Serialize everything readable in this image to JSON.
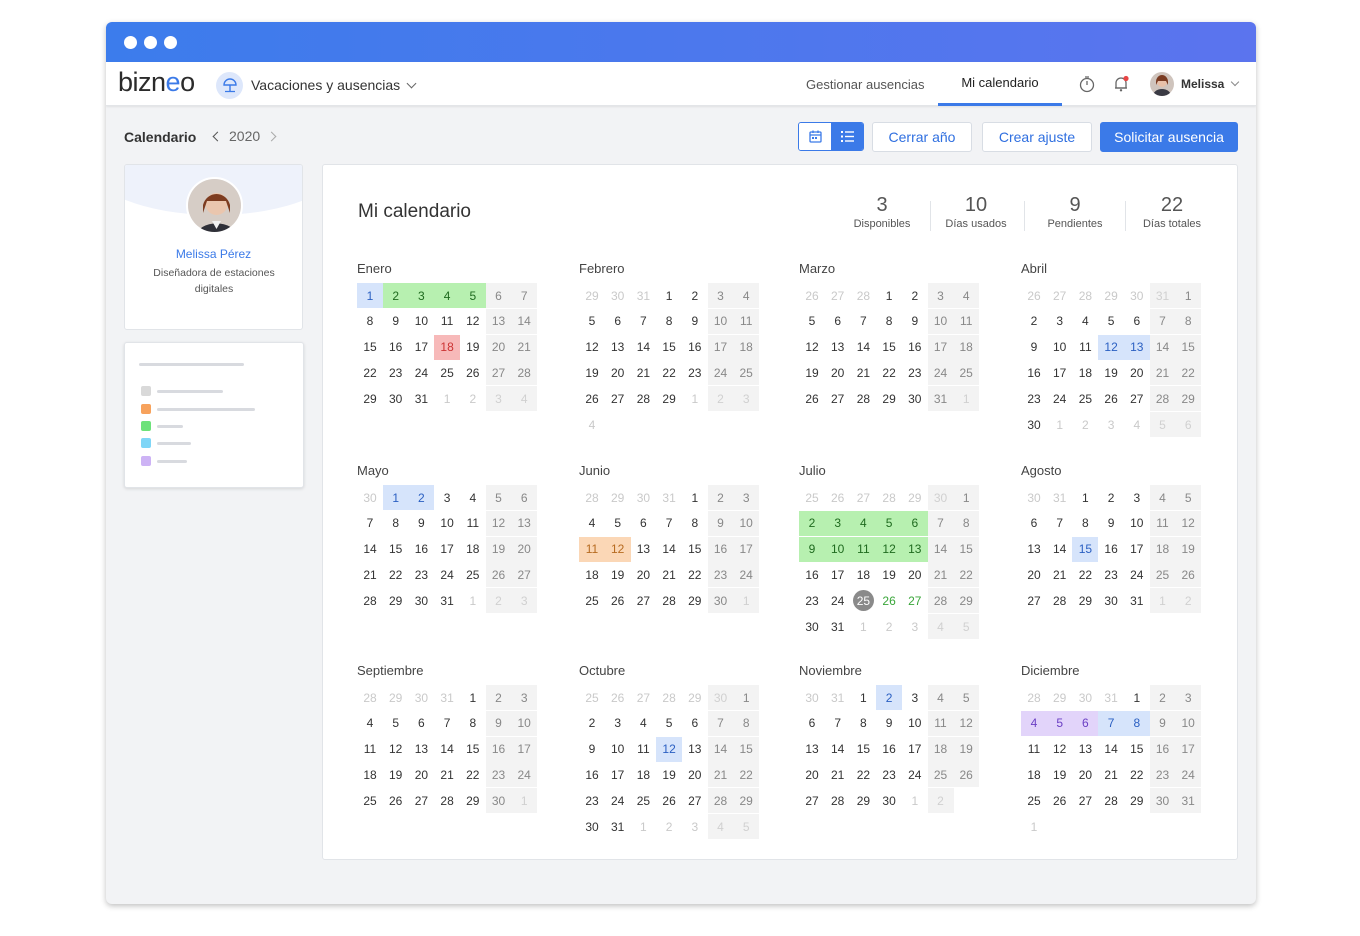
{
  "app": {
    "logo_text": "bizneo",
    "module_label": "Vacaciones y ausencias",
    "nav_tabs": [
      {
        "label": "Gestionar ausencias",
        "active": false
      },
      {
        "label": "Mi calendario",
        "active": true
      }
    ],
    "user_name": "Melissa",
    "colors": {
      "accent": "#3b7ae8",
      "titlebar_start": "#3c7cec",
      "titlebar_end": "#5b74ee"
    }
  },
  "toolbar": {
    "breadcrumb": "Calendario",
    "year": "2020",
    "close_year": "Cerrar año",
    "create_adjustment": "Crear ajuste",
    "request_absence": "Solicitar ausencia"
  },
  "profile": {
    "name": "Melissa Pérez",
    "role": "Diseñadora de estaciones digitales"
  },
  "legend_colors": [
    "#d9d9d9",
    "#f7a25c",
    "#6de27a",
    "#7fd6f7",
    "#cdb3f5"
  ],
  "calendar": {
    "title": "Mi calendario",
    "stats": [
      {
        "value": "3",
        "label": "Disponibles"
      },
      {
        "value": "10",
        "label": "Días usados"
      },
      {
        "value": "9",
        "label": "Pendientes"
      },
      {
        "value": "22",
        "label": "Días totales"
      }
    ],
    "months": [
      {
        "name": "Enero",
        "lead": [],
        "days": 31,
        "trail": [
          1,
          2,
          3,
          4
        ],
        "start": 0,
        "marks": {
          "1": "blue",
          "2": "green",
          "3": "green",
          "4": "green",
          "5": "green",
          "18": "red"
        }
      },
      {
        "name": "Febrero",
        "lead": [
          29,
          30,
          31
        ],
        "days": 29,
        "trail": [
          1,
          2,
          3,
          4
        ],
        "start": 3,
        "marks": {}
      },
      {
        "name": "Marzo",
        "lead": [
          26,
          27,
          28
        ],
        "days": 31,
        "trail": [
          1
        ],
        "start": 3,
        "marks": {}
      },
      {
        "name": "Abril",
        "lead": [
          26,
          27,
          28,
          29,
          30,
          31
        ],
        "days": 30,
        "trail": [
          1,
          2,
          3,
          4,
          5,
          6
        ],
        "start": 6,
        "marks": {
          "12": "blue",
          "13": "blue"
        }
      },
      {
        "name": "Mayo",
        "lead": [
          30
        ],
        "days": 31,
        "trail": [
          1,
          2,
          3
        ],
        "start": 1,
        "marks": {
          "1": "blue",
          "2": "blue"
        }
      },
      {
        "name": "Junio",
        "lead": [
          28,
          29,
          30,
          31
        ],
        "days": 30,
        "trail": [
          1
        ],
        "start": 4,
        "marks": {
          "11": "orange",
          "12": "orange"
        }
      },
      {
        "name": "Julio",
        "lead": [
          25,
          26,
          27,
          28,
          29,
          30
        ],
        "days": 31,
        "trail": [
          1,
          2,
          3,
          4,
          5
        ],
        "start": 6,
        "marks": {
          "2": "green",
          "3": "green",
          "4": "green",
          "5": "green",
          "6": "green",
          "9": "green",
          "10": "green",
          "11": "green",
          "12": "green",
          "13": "green",
          "25": "today",
          "26": "greentxt",
          "27": "greentxt"
        }
      },
      {
        "name": "Agosto",
        "lead": [
          30,
          31
        ],
        "days": 31,
        "trail": [
          1,
          2
        ],
        "start": 2,
        "marks": {
          "15": "blue"
        }
      },
      {
        "name": "Septiembre",
        "lead": [
          28,
          29,
          30,
          31
        ],
        "days": 30,
        "trail": [
          1
        ],
        "start": 4,
        "marks": {}
      },
      {
        "name": "Octubre",
        "lead": [
          25,
          26,
          27,
          28,
          29,
          30
        ],
        "days": 31,
        "trail": [
          1,
          2,
          3,
          4,
          5
        ],
        "start": 6,
        "marks": {
          "12": "blue"
        }
      },
      {
        "name": "Noviembre",
        "lead": [
          30,
          31
        ],
        "days": 30,
        "trail": [
          1,
          2
        ],
        "start": 2,
        "marks": {
          "2": "blue"
        }
      },
      {
        "name": "Diciembre",
        "lead": [
          28,
          29,
          30,
          31
        ],
        "days": 31,
        "trail": [
          1
        ],
        "start": 4,
        "marks": {
          "4": "purple",
          "5": "purple",
          "6": "purple",
          "7": "blue",
          "8": "blue"
        }
      }
    ]
  }
}
